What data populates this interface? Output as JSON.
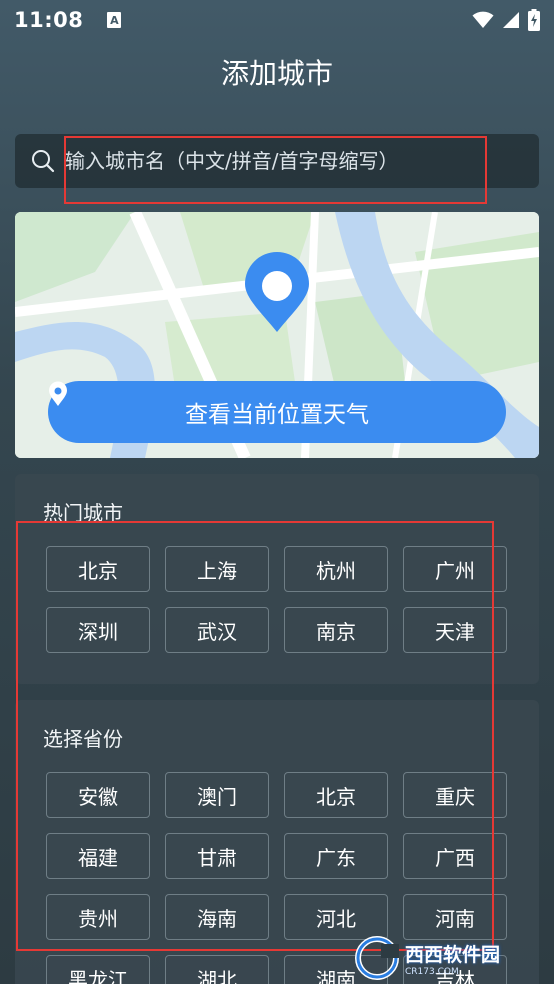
{
  "status_bar": {
    "time": "11:08",
    "notification_letter": "A"
  },
  "header": {
    "title": "添加城市"
  },
  "search": {
    "placeholder": "输入城市名（中文/拼音/首字母缩写）",
    "value": ""
  },
  "map_card": {
    "locate_label": "查看当前位置天气"
  },
  "hot_cities": {
    "title": "热门城市",
    "items": [
      "北京",
      "上海",
      "杭州",
      "广州",
      "深圳",
      "武汉",
      "南京",
      "天津"
    ]
  },
  "provinces": {
    "title": "选择省份",
    "items": [
      "安徽",
      "澳门",
      "北京",
      "重庆",
      "福建",
      "甘肃",
      "广东",
      "广西",
      "贵州",
      "海南",
      "河北",
      "河南",
      "黑龙江",
      "湖北",
      "湖南",
      "吉林"
    ]
  },
  "watermark": {
    "text": "西西软件园",
    "subtext": "CR173.COM"
  },
  "colors": {
    "accent_blue": "#3b8cf0",
    "annotation_red": "#e53935",
    "background_top": "#425a68",
    "background_bottom": "#2d3b42"
  },
  "icons": {
    "search": "search-icon",
    "location_pin": "map-pin-icon",
    "wifi": "wifi-icon",
    "signal": "signal-icon",
    "battery": "battery-charging-icon"
  }
}
